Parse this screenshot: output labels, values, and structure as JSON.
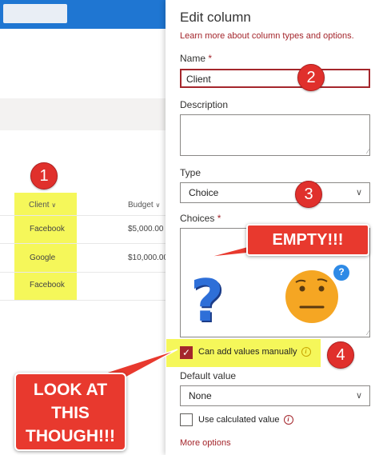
{
  "background_list": {
    "columns": [
      {
        "label": "Client",
        "chevron": "chevron-down-icon"
      },
      {
        "label": "Budget",
        "chevron": "chevron-down-icon"
      }
    ],
    "rows": [
      {
        "client": "Facebook",
        "budget": "$5,000.00"
      },
      {
        "client": "Google",
        "budget": "$10,000.00"
      },
      {
        "client": "Facebook",
        "budget": ""
      }
    ]
  },
  "panel": {
    "title": "Edit column",
    "learn_link": "Learn more about column types and options.",
    "name_label": "Name",
    "required_mark": "*",
    "name_value": "Client",
    "description_label": "Description",
    "description_value": "",
    "type_label": "Type",
    "type_value": "Choice",
    "choices_label": "Choices",
    "choices_value": "",
    "can_add_label": "Can add values manually",
    "can_add_checked": true,
    "default_label": "Default value",
    "default_value": "None",
    "use_calc_label": "Use calculated value",
    "use_calc_checked": false,
    "more_options": "More options",
    "info_icon_text": "i"
  },
  "annotations": {
    "badges": [
      "1",
      "2",
      "3",
      "4"
    ],
    "callout_empty": "EMPTY!!!",
    "callout_look_lines": [
      "LOOK AT",
      "THIS",
      "THOUGH!!!"
    ],
    "question_mark": "?",
    "face_question": "?"
  },
  "colors": {
    "accent": "#a4262c",
    "highlight": "#f5f75a",
    "callout_red": "#e8392e",
    "topbar_blue": "#1f76d2",
    "question_blue": "#2e6fd8",
    "emoji_orange": "#f5a623"
  }
}
